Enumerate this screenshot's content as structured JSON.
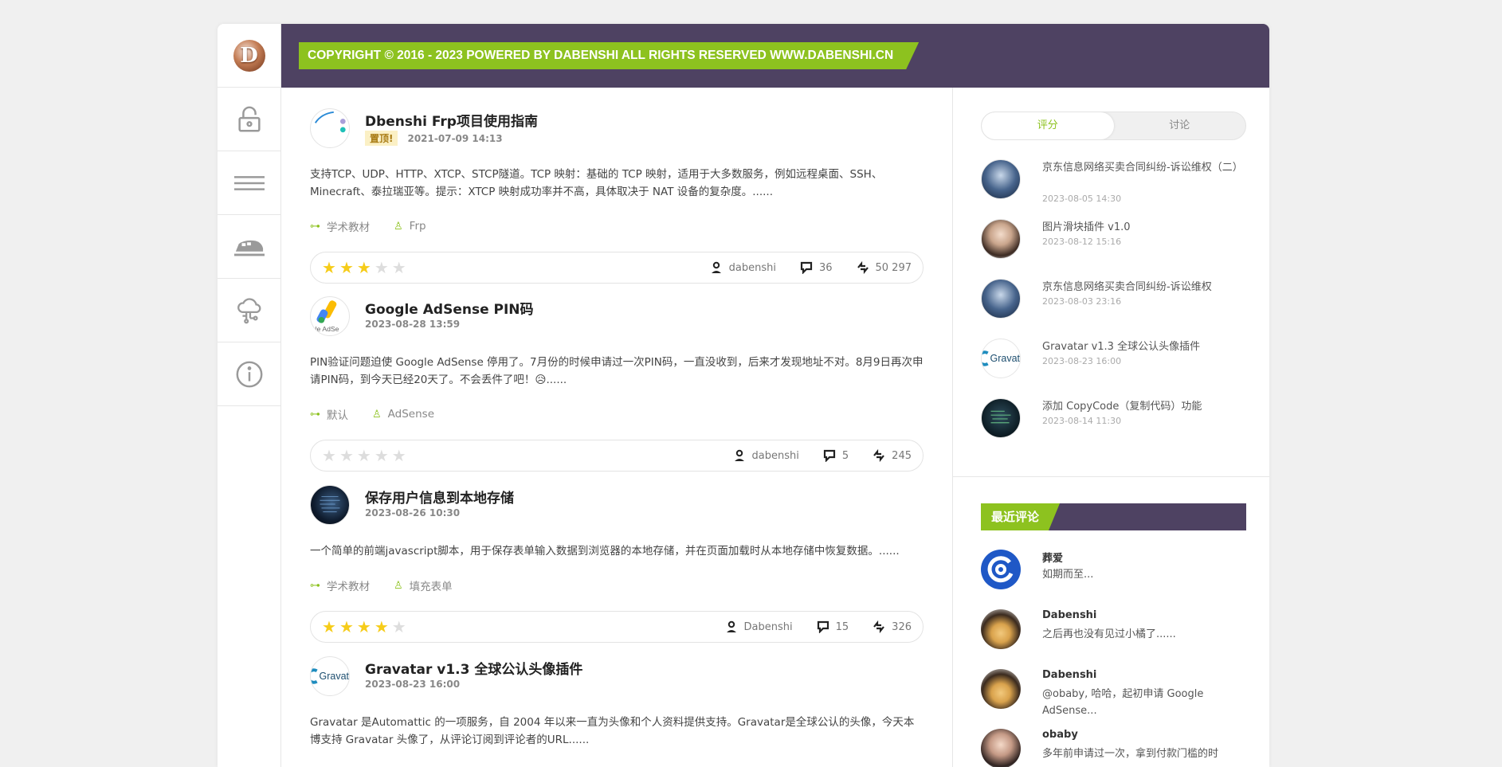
{
  "brand": {
    "logo_letter": "D"
  },
  "nav": {
    "items": [
      {
        "name": "lock"
      },
      {
        "name": "menu"
      },
      {
        "name": "train"
      },
      {
        "name": "cloud"
      },
      {
        "name": "info"
      }
    ]
  },
  "header": {
    "copyright": "COPYRIGHT © 2016 - 2023 POWERED BY DABENSHI ALL RIGHTS RESERVED WWW.DABENSHI.CN"
  },
  "colors": {
    "accent": "#8dc21f",
    "header": "#4e4262",
    "star": "#f6cc19"
  },
  "posts": [
    {
      "title": "Dbenshi Frp项目使用指南",
      "badge": "置顶!",
      "date": "2021-07-09 14:13",
      "excerpt": "支持TCP、UDP、HTTP、XTCP、STCP隧道。TCP 映射：基础的 TCP 映射，适用于大多数服务，例如远程桌面、SSH、Minecraft、泰拉瑞亚等。提示：XTCP 映射成功率并不高，具体取决于 NAT 设备的复杂度。......",
      "category": "学术教材",
      "tag": "Frp",
      "rating": 3,
      "author": "dabenshi",
      "comments": "36",
      "views": "50 297"
    },
    {
      "title": "Google AdSense PIN码",
      "badge": "",
      "date": "2023-08-28 13:59",
      "excerpt": "PIN验证问题迫使 Google AdSense 停用了。7月份的时候申请过一次PIN码，一直没收到，后来才发现地址不对。8月9日再次申请PIN码，到今天已经20天了。不会丢件了吧！😥......",
      "category": "默认",
      "tag": "AdSense",
      "rating": 0,
      "author": "dabenshi",
      "comments": "5",
      "views": "245"
    },
    {
      "title": "保存用户信息到本地存储",
      "badge": "",
      "date": "2023-08-26 10:30",
      "excerpt": "一个简单的前端javascript脚本，用于保存表单输入数据到浏览器的本地存储，并在页面加载时从本地存储中恢复数据。......",
      "category": "学术教材",
      "tag": "填充表单",
      "rating": 4,
      "author": "Dabenshi",
      "comments": "15",
      "views": "326"
    },
    {
      "title": "Gravatar v1.3 全球公认头像插件",
      "badge": "",
      "date": "2023-08-23 16:00",
      "excerpt": "Gravatar 是Automattic 的一项服务，自 2004 年以来一直为头像和个人资料提供支持。Gravatar是全球公认的头像，今天本博支持 Gravatar 头像了，从评论订阅到评论者的URL......"
    }
  ],
  "sidebar": {
    "tabs": [
      "评分",
      "讨论"
    ],
    "items": [
      {
        "title": "京东信息网络买卖合同纠纷-诉讼维权（二）",
        "date": "2023-08-05 14:30"
      },
      {
        "title": "图片滑块插件 v1.0",
        "date": "2023-08-12 15:16"
      },
      {
        "title": "京东信息网络买卖合同纠纷-诉讼维权",
        "date": "2023-08-03 23:16"
      },
      {
        "title": "Gravatar v1.3 全球公认头像插件",
        "date": "2023-08-23 16:00"
      },
      {
        "title": "添加 CopyCode（复制代码）功能",
        "date": "2023-08-14 11:30"
      }
    ],
    "comments_title": "最近评论",
    "comments": [
      {
        "name": "葬爱",
        "text": "如期而至..."
      },
      {
        "name": "Dabenshi",
        "text": "之后再也没有见过小橘了......"
      },
      {
        "name": "Dabenshi",
        "text": "@obaby, 哈哈，起初申请 Google AdSense..."
      },
      {
        "name": "obaby",
        "text": "多年前申请过一次，拿到付款门槛的时"
      }
    ]
  }
}
